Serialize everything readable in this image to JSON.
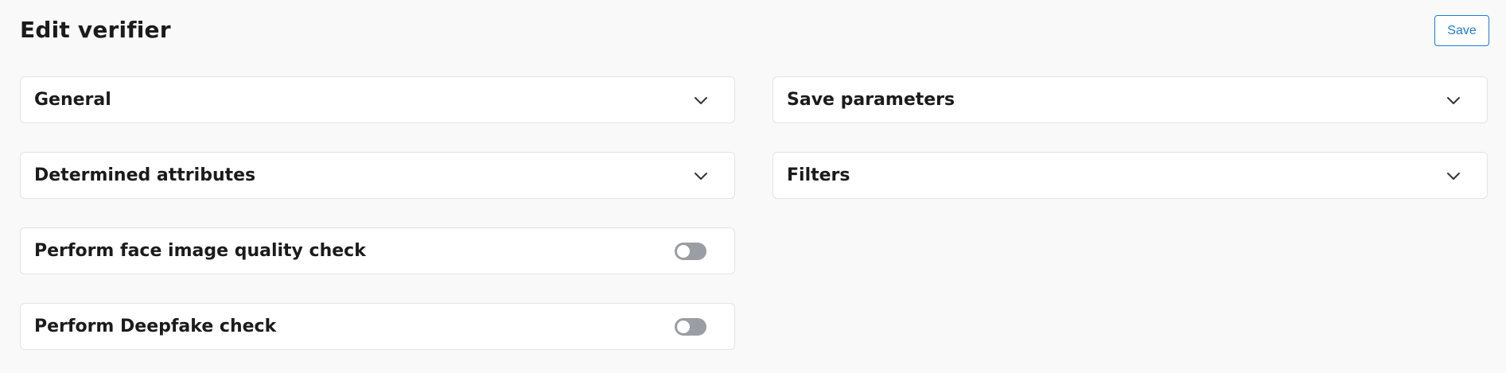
{
  "header": {
    "title": "Edit verifier",
    "save_label": "Save"
  },
  "colors": {
    "accent": "#1a7fd4",
    "toggle_off": "#9a9da3",
    "background": "#f9f9f9"
  },
  "sections": {
    "general": {
      "label": "General",
      "icon": "chevron-down-icon",
      "expanded": false
    },
    "determined_attributes": {
      "label": "Determined attributes",
      "icon": "chevron-down-icon",
      "expanded": false
    },
    "save_parameters": {
      "label": "Save parameters",
      "icon": "chevron-down-icon",
      "expanded": false
    },
    "filters": {
      "label": "Filters",
      "icon": "chevron-down-icon",
      "expanded": false
    }
  },
  "toggles": {
    "face_quality": {
      "label": "Perform face image quality check",
      "enabled": false
    },
    "deepfake": {
      "label": "Perform Deepfake check",
      "enabled": false
    }
  }
}
